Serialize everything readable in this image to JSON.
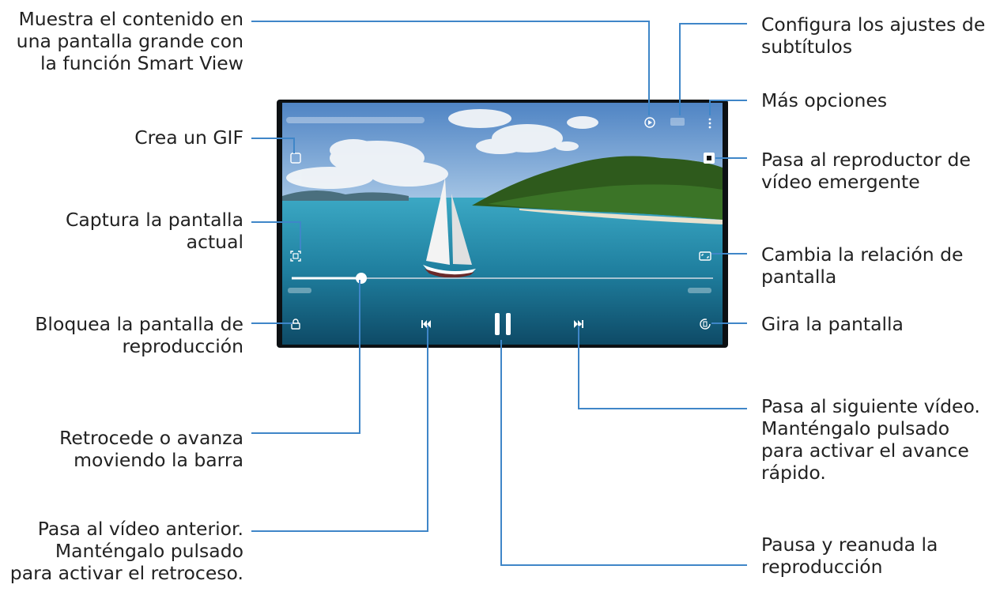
{
  "callouts": {
    "smart_view": "Muestra el contenido en\nuna pantalla grande con\nla función Smart View",
    "gif": "Crea un GIF",
    "capture": "Captura la pantalla\nactual",
    "lock": "Bloquea la pantalla de\nreproducción",
    "seek": "Retrocede o avanza\nmoviendo la barra",
    "previous": "Pasa al vídeo anterior.\nManténgalo pulsado\npara activar el retroceso.",
    "subtitles": "Configura los ajustes de\nsubtítulos",
    "more": "Más opciones",
    "popup": "Pasa al reproductor de\nvídeo emergente",
    "ratio": "Cambia la relación de\npantalla",
    "rotate": "Gira la pantalla",
    "next": "Pasa al siguiente vídeo.\nManténgalo pulsado\npara activar el avance\nrápido.",
    "pause": "Pausa y reanuda la\nreproducción"
  },
  "player": {
    "progress": 0.2
  },
  "colors": {
    "line": "#3f86c8",
    "sky": "#6f9fd0",
    "sea": "#2f90b0"
  },
  "icons": [
    "smart-view-icon",
    "subtitle-icon",
    "more-options-icon",
    "gif-icon",
    "popup-player-icon",
    "capture-icon",
    "aspect-ratio-icon",
    "lock-icon",
    "previous-icon",
    "pause-icon",
    "next-icon",
    "rotate-icon"
  ]
}
